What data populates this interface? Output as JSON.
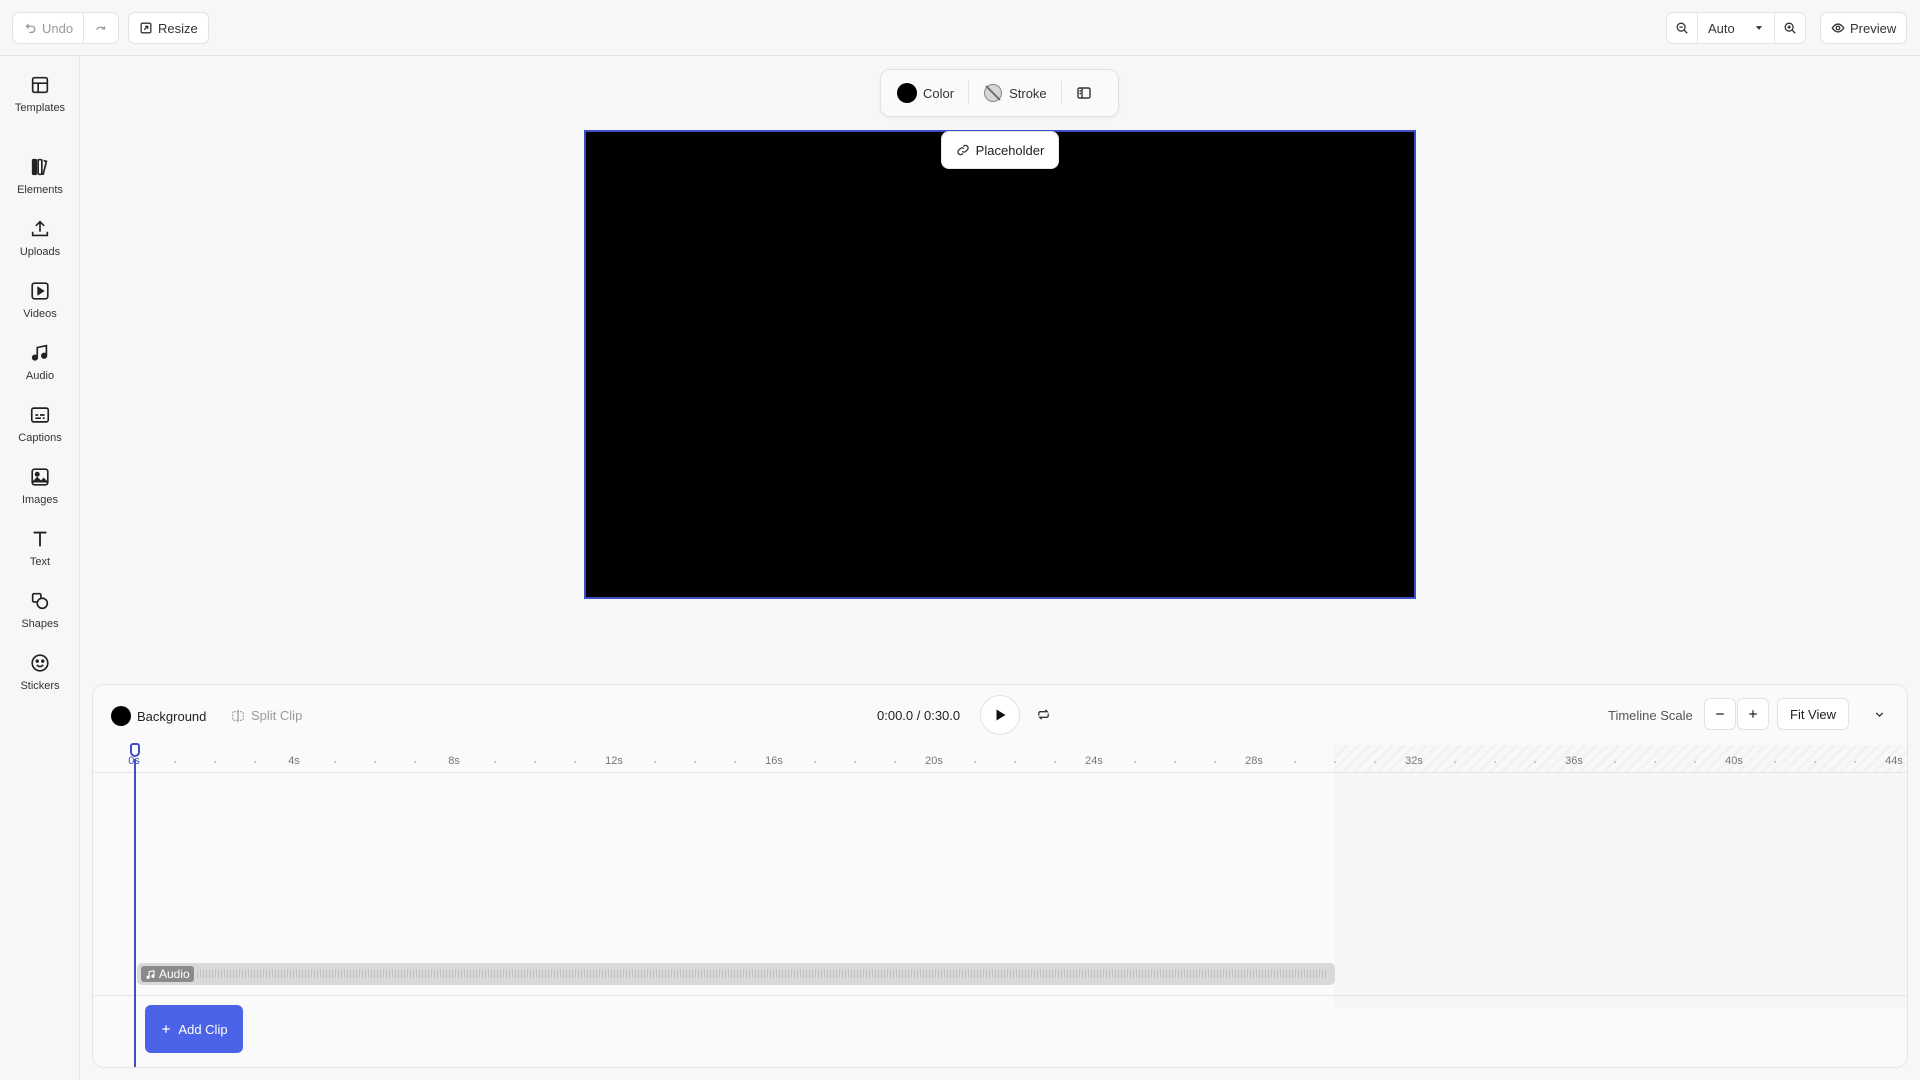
{
  "topbar": {
    "undo_label": "Undo",
    "resize_label": "Resize",
    "zoom_value": "Auto",
    "preview_label": "Preview"
  },
  "sidebar": {
    "items": [
      {
        "label": "Templates",
        "icon": "layout-icon"
      },
      {
        "label": "Elements",
        "icon": "elements-icon"
      },
      {
        "label": "Uploads",
        "icon": "upload-icon"
      },
      {
        "label": "Videos",
        "icon": "video-icon"
      },
      {
        "label": "Audio",
        "icon": "music-icon"
      },
      {
        "label": "Captions",
        "icon": "captions-icon"
      },
      {
        "label": "Images",
        "icon": "image-icon"
      },
      {
        "label": "Text",
        "icon": "text-icon"
      },
      {
        "label": "Shapes",
        "icon": "shapes-icon"
      },
      {
        "label": "Stickers",
        "icon": "sticker-icon"
      }
    ]
  },
  "toolbar": {
    "color_label": "Color",
    "stroke_label": "Stroke",
    "fill_color": "#000000"
  },
  "canvas": {
    "placeholder_label": "Placeholder",
    "background": "#000000",
    "selection_color": "#3d4fc7"
  },
  "timeline": {
    "background_label": "Background",
    "split_clip_label": "Split Clip",
    "time_display": "0:00.0 / 0:30.0",
    "scale_label": "Timeline Scale",
    "fit_view_label": "Fit View",
    "ruler_ticks": [
      "0s",
      "4s",
      "8s",
      "12s",
      "16s",
      "20s",
      "24s",
      "28s",
      "32s",
      "36s",
      "40s",
      "44s"
    ],
    "audio_label": "Audio",
    "add_clip_label": "Add Clip",
    "accent": "#4a63e7"
  }
}
